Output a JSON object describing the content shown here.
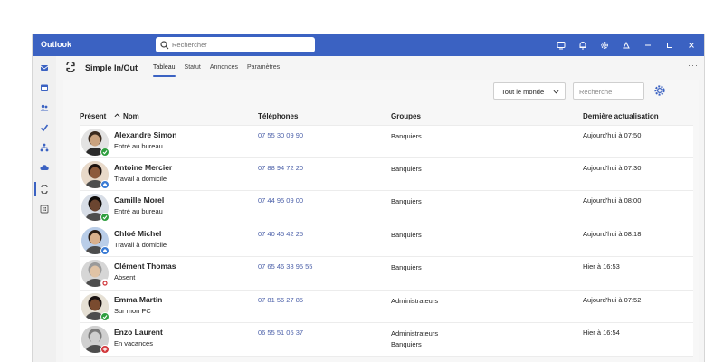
{
  "titlebar": {
    "app_title": "Outlook",
    "search_placeholder": "Rechercher",
    "icons": [
      "meet-now-icon",
      "bell-icon",
      "gear-icon",
      "copilot-icon",
      "minimize-icon",
      "maximize-icon",
      "close-icon"
    ]
  },
  "rail": {
    "icons": [
      "mail-icon",
      "calendar-icon",
      "people-icon",
      "todo-check-icon",
      "org-chart-icon",
      "cloud-icon",
      "simple-in-out-icon",
      "apps-icon"
    ]
  },
  "app": {
    "name": "Simple In/Out",
    "tabs": [
      {
        "label": "Tableau",
        "active": true
      },
      {
        "label": "Statut",
        "active": false
      },
      {
        "label": "Annonces",
        "active": false
      },
      {
        "label": "Paramètres",
        "active": false
      }
    ],
    "more": "···"
  },
  "filters": {
    "group_filter": "Tout le monde",
    "search_placeholder": "Recherche"
  },
  "table": {
    "headers": {
      "present": "Présent",
      "name": "Nom",
      "phones": "Téléphones",
      "groups": "Groupes",
      "last_update": "Dernière actualisation"
    },
    "rows": [
      {
        "name": "Alexandre Simon",
        "status": "Entré au bureau",
        "status_type": "in",
        "phone": "07 55 30 09 90",
        "groups": [
          "Banquiers"
        ],
        "updated": "Aujourd'hui à 07:50"
      },
      {
        "name": "Antoine Mercier",
        "status": "Travail à domicile",
        "status_type": "home",
        "phone": "07 88 94 72 20",
        "groups": [
          "Banquiers"
        ],
        "updated": "Aujourd'hui à 07:30"
      },
      {
        "name": "Camille Morel",
        "status": "Entré au bureau",
        "status_type": "in",
        "phone": "07 44 95 09 00",
        "groups": [
          "Banquiers"
        ],
        "updated": "Aujourd'hui à 08:00"
      },
      {
        "name": "Chloé Michel",
        "status": "Travail à domicile",
        "status_type": "home",
        "phone": "07 40 45 42 25",
        "groups": [
          "Banquiers"
        ],
        "updated": "Aujourd'hui à 08:18"
      },
      {
        "name": "Clément Thomas",
        "status": "Absent",
        "status_type": "out",
        "phone": "07 65 46 38 95 55",
        "groups": [
          "Banquiers"
        ],
        "updated": "Hier à 16:53"
      },
      {
        "name": "Emma Martin",
        "status": "Sur mon PC",
        "status_type": "in",
        "phone": "07 81 56 27 85",
        "groups": [
          "Administrateurs"
        ],
        "updated": "Aujourd'hui à 07:52"
      },
      {
        "name": "Enzo Laurent",
        "status": "En vacances",
        "status_type": "vacation",
        "phone": "06 55 51 05 37",
        "groups": [
          "Administrateurs",
          "Banquiers"
        ],
        "updated": "Hier à 16:54"
      }
    ]
  },
  "colors": {
    "titlebar": "#3b62c2",
    "status_in": "#2e9e3e",
    "status_home": "#3a7bd5",
    "status_out": "#d13438",
    "phone_link": "#4a5fa8"
  }
}
